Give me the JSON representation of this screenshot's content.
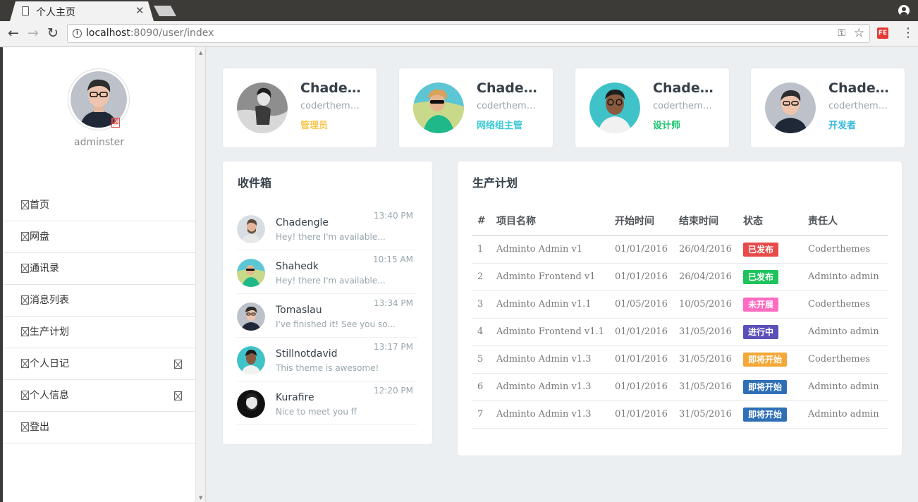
{
  "browser": {
    "tab_title": "个人主页",
    "tab_close": "✕",
    "url_host": "localhost",
    "url_rest": ":8090/user/index",
    "ext_label": "FE"
  },
  "sidebar": {
    "username": "adminster",
    "menu": [
      {
        "label": "首页",
        "has_arrow": false
      },
      {
        "label": "网盘",
        "has_arrow": false
      },
      {
        "label": "通讯录",
        "has_arrow": false
      },
      {
        "label": "消息列表",
        "has_arrow": false
      },
      {
        "label": "生产计划",
        "has_arrow": false
      },
      {
        "label": "个人日记",
        "has_arrow": true
      },
      {
        "label": "个人信息",
        "has_arrow": true
      },
      {
        "label": "登出",
        "has_arrow": false
      }
    ]
  },
  "user_cards": [
    {
      "name": "Chadengle",
      "sub": "coderthemes@gmail.com",
      "role": "管理员",
      "role_color": "#f9c851"
    },
    {
      "name": "Chadengle",
      "sub": "coderthemes@gmail.com",
      "role": "网络组主管",
      "role_color": "#3ac9d6"
    },
    {
      "name": "Chadengle",
      "sub": "coderthemes@gmail.com",
      "role": "设计师",
      "role_color": "#10c469"
    },
    {
      "name": "Chadengle",
      "sub": "coderthemes@gmail.com",
      "role": "开发者",
      "role_color": "#35b8e0"
    }
  ],
  "inbox": {
    "title": "收件箱",
    "items": [
      {
        "name": "Chadengle",
        "msg": "Hey! there I'm available...",
        "time": "13:40 PM"
      },
      {
        "name": "Shahedk",
        "msg": "Hey! there I'm available...",
        "time": "10:15 AM"
      },
      {
        "name": "Tomaslau",
        "msg": "I've finished it! See you so...",
        "time": "13:34 PM"
      },
      {
        "name": "Stillnotdavid",
        "msg": "This theme is awesome!",
        "time": "13:17 PM"
      },
      {
        "name": "Kurafire",
        "msg": "Nice to meet you ff",
        "time": "12:20 PM"
      }
    ]
  },
  "plan": {
    "title": "生产计划",
    "headers": [
      "#",
      "项目名称",
      "开始时间",
      "结束时间",
      "状态",
      "责任人"
    ],
    "rows": [
      {
        "id": "1",
        "project": "Adminto Admin v1",
        "start": "01/01/2016",
        "end": "26/04/2016",
        "status": "已发布",
        "status_color": "#e84a4a",
        "owner": "Coderthemes"
      },
      {
        "id": "2",
        "project": "Adminto Frontend v1",
        "start": "01/01/2016",
        "end": "26/04/2016",
        "status": "已发布",
        "status_color": "#1ec35c",
        "owner": "Adminto admin"
      },
      {
        "id": "3",
        "project": "Adminto Admin v1.1",
        "start": "01/05/2016",
        "end": "10/05/2016",
        "status": "未开展",
        "status_color": "#ff6bc1",
        "owner": "Coderthemes"
      },
      {
        "id": "4",
        "project": "Adminto Frontend v1.1",
        "start": "01/01/2016",
        "end": "31/05/2016",
        "status": "进行中",
        "status_color": "#5b4fb8",
        "owner": "Adminto admin"
      },
      {
        "id": "5",
        "project": "Adminto Admin v1.3",
        "start": "01/01/2016",
        "end": "31/05/2016",
        "status": "即将开始",
        "status_color": "#f4a838",
        "owner": "Coderthemes"
      },
      {
        "id": "6",
        "project": "Adminto Admin v1.3",
        "start": "01/01/2016",
        "end": "31/05/2016",
        "status": "即将开始",
        "status_color": "#2f6fb6",
        "owner": "Adminto admin"
      },
      {
        "id": "7",
        "project": "Adminto Admin v1.3",
        "start": "01/01/2016",
        "end": "31/05/2016",
        "status": "即将开始",
        "status_color": "#2f6fb6",
        "owner": "Adminto admin"
      }
    ]
  }
}
